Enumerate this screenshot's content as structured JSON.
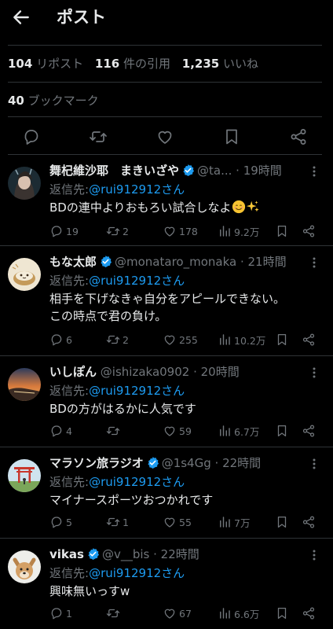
{
  "header": {
    "title": "ポスト"
  },
  "stats": {
    "reposts_count": "104",
    "reposts_label": "リポスト",
    "quotes_count": "116",
    "quotes_label": "件の引用",
    "likes_count": "1,235",
    "likes_label": "いいね",
    "bookmarks_count": "40",
    "bookmarks_label": "ブックマーク"
  },
  "replying_label": "返信先:",
  "replies": [
    {
      "name": "舞杞維沙耶　まきいざや",
      "handle": "@ta...",
      "time": "19時間",
      "replying_to": "@rui912912さん",
      "text": "BDの連中よりおもろい試合しなよ",
      "emoji": [
        "smiling-face-emoji",
        "sparkles-emoji"
      ],
      "replies_count": "19",
      "reposts_count": "2",
      "likes_count": "178",
      "views_count": "9.2万"
    },
    {
      "name": "もな太郎",
      "handle": "@monataro_monaka",
      "time": "21時間",
      "replying_to": "@rui912912さん",
      "text_line1": "相手を下げなきゃ自分をアピールできない。",
      "text_line2": "この時点で君の負け。",
      "replies_count": "6",
      "reposts_count": "2",
      "likes_count": "255",
      "views_count": "10.2万"
    },
    {
      "name": "いしぽん",
      "handle": "@ishizaka0902",
      "time": "20時間",
      "replying_to": "@rui912912さん",
      "text": "BDの方がはるかに人気です",
      "replies_count": "4",
      "reposts_count": "",
      "likes_count": "59",
      "views_count": "6.7万"
    },
    {
      "name": "マラソン旅ラジオ",
      "handle": "@1s4Gg",
      "time": "22時間",
      "replying_to": "@rui912912さん",
      "text": "マイナースポーツおつかれです",
      "replies_count": "5",
      "reposts_count": "1",
      "likes_count": "55",
      "views_count": "7万"
    },
    {
      "name": "vikas",
      "handle": "@v__bis",
      "time": "22時間",
      "replying_to": "@rui912912さん",
      "text": "興味無いっすw",
      "replies_count": "1",
      "reposts_count": "",
      "likes_count": "67",
      "views_count": "6.6万"
    }
  ],
  "colors": {
    "background": "#000000",
    "text": "#e7e9ea",
    "muted": "#71767b",
    "accent": "#1d9bf0",
    "divider": "#2f3336"
  }
}
